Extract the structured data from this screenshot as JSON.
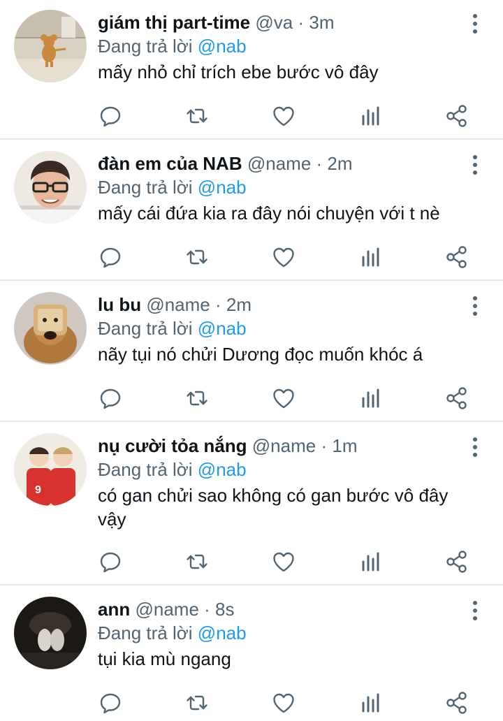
{
  "reply_prefix": "Đang trả lời",
  "tweets": [
    {
      "name": "giám thị part-time",
      "handle": "@va",
      "sep": "·",
      "time": "3m",
      "reply_to": "@nab",
      "text": "mấy nhỏ chỉ trích ebe bước vô đây",
      "avatar": "avatar-cartoon-mouse"
    },
    {
      "name": "đàn em của NAB",
      "handle": "@name",
      "sep": "·",
      "time": "2m",
      "reply_to": "@nab",
      "text": "mấy cái đứa kia ra đây nói chuyện với t nè",
      "avatar": "avatar-man-glasses"
    },
    {
      "name": "lu bu",
      "handle": "@name",
      "sep": "·",
      "time": "2m",
      "reply_to": "@nab",
      "text": "nãy tụi nó chửi Dương đọc muốn khóc á",
      "avatar": "avatar-dog-bread"
    },
    {
      "name": "nụ cười tỏa nắng",
      "handle": "@name",
      "sep": "·",
      "time": "1m",
      "reply_to": "@nab",
      "text": "có gan chửi sao không có gan bước vô đây vậy",
      "avatar": "avatar-anime-players"
    },
    {
      "name": "ann",
      "handle": "@name",
      "sep": "·",
      "time": "8s",
      "reply_to": "@nab",
      "text": "tụi kia mù ngang",
      "avatar": "avatar-dark-photo"
    }
  ],
  "actions": [
    "reply-icon",
    "retweet-icon",
    "like-icon",
    "analytics-icon",
    "share-icon"
  ],
  "colors": {
    "mention": "#1d9bf0",
    "muted": "#536471",
    "text": "#0f1419",
    "divider": "#e4e8eb"
  }
}
